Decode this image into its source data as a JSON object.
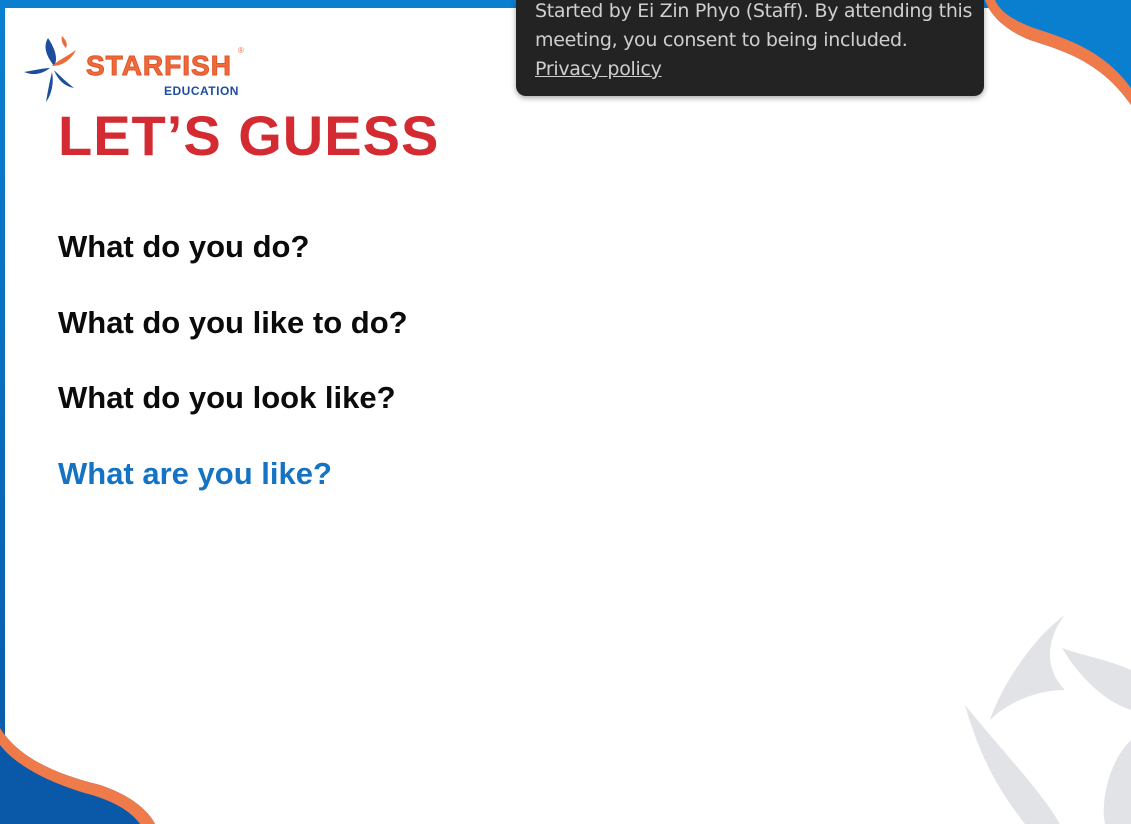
{
  "slide": {
    "title": "LET’S GUESS",
    "questions": [
      "What do you do?",
      "What do you like to do?",
      "What do you look like?",
      "What are you like?"
    ]
  },
  "logo": {
    "name": "STARFISH",
    "sub": "EDUCATION",
    "registered_mark": "®"
  },
  "meeting_notice": {
    "text": "Started by Ei Zin Phyo (Staff). By attending this meeting, you consent to being included.",
    "link_label": "Privacy policy"
  },
  "colors": {
    "title_red": "#d42a31",
    "highlight_blue": "#1673c4",
    "brand_orange": "#ef6a3a",
    "brand_navy": "#1d4e9e",
    "frame_blue": "#0a7fd0",
    "toast_bg": "#232323"
  },
  "icons": [
    "starfish-logo-icon",
    "starfish-watermark-icon"
  ]
}
